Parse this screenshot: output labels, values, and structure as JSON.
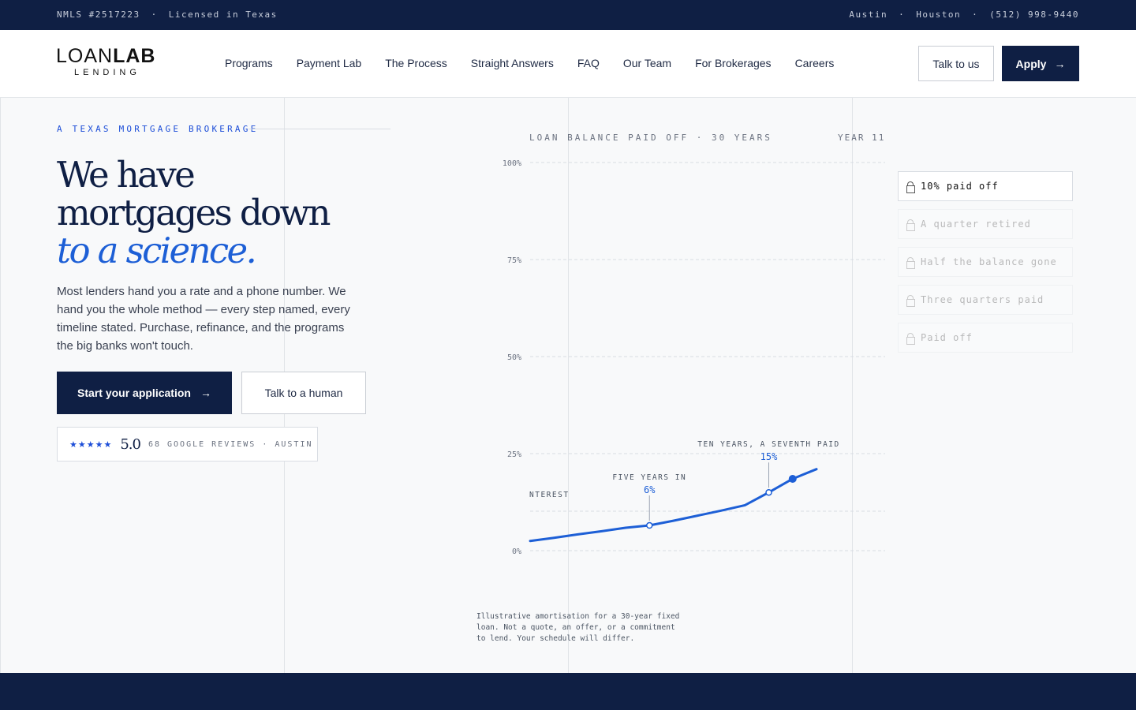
{
  "topbar": {
    "nmls": "NMLS #2517223",
    "license": "Licensed in Texas",
    "city1": "Austin",
    "city2": "Houston",
    "phone": "(512) 998-9440",
    "sep": "·"
  },
  "brand": {
    "name_a": "LOAN",
    "name_b": "LAB",
    "sub": "LENDING"
  },
  "nav": [
    "Programs",
    "Payment Lab",
    "The Process",
    "Straight Answers",
    "FAQ",
    "Our Team",
    "For Brokerages",
    "Careers"
  ],
  "header": {
    "talk_label": "Talk to us",
    "apply_label": "Apply",
    "arrow": "→"
  },
  "hero": {
    "eyebrow": "A TEXAS MORTGAGE BROKERAGE",
    "line1": "We have",
    "line2": "mortgages down",
    "line3": "to a science.",
    "lede": "Most lenders hand you a rate and a phone number. We hand you the whole method — every step named, every timeline stated. Purchase, refinance, and the programs the big banks won't touch.",
    "cta_primary": "Start your application",
    "cta_secondary": "Talk to a human",
    "stars": "★★★★★",
    "score": "5.0",
    "reviews_meta": "68 GOOGLE REVIEWS · AUSTIN"
  },
  "chart_header": {
    "title": "LOAN BALANCE PAID OFF · 30 YEARS",
    "year": "YEAR 11"
  },
  "milestones": [
    {
      "label": "10% paid off",
      "active": true
    },
    {
      "label": "A quarter retired",
      "active": false
    },
    {
      "label": "Half the balance gone",
      "active": false
    },
    {
      "label": "Three quarters paid",
      "active": false
    },
    {
      "label": "Paid off",
      "active": false
    }
  ],
  "disclaimer": "Illustrative amortisation for a 30-year fixed loan. Not a quote, an offer, or a commitment to lend. Your schedule will differ.",
  "chart_data": {
    "type": "line",
    "ylim": [
      0,
      100
    ],
    "xlim": [
      0,
      13
    ],
    "y_ticks": [
      "100%",
      "75%",
      "50%",
      "25%",
      "0%"
    ],
    "interest_label": "NTEREST",
    "series": [
      {
        "x": [
          0,
          1,
          2,
          3,
          4,
          5,
          6,
          7,
          8,
          9,
          10,
          11,
          12
        ],
        "y": [
          2.5,
          3.3,
          4.2,
          5.0,
          5.9,
          6.5,
          7.7,
          9.0,
          10.3,
          11.7,
          15.0,
          18.5,
          21.0
        ]
      }
    ],
    "annotations": [
      {
        "x": 5,
        "y": 6.5,
        "label": "FIVE YEARS IN",
        "value": "6%"
      },
      {
        "x": 10,
        "y": 15.0,
        "label": "TEN YEARS, A SEVENTH PAID",
        "value": "15%"
      }
    ],
    "current": {
      "x": 11,
      "y": 18.5
    },
    "colors": {
      "line": "#1d5fd6",
      "grid": "#d9dde3",
      "navy": "#0f1f44"
    }
  }
}
